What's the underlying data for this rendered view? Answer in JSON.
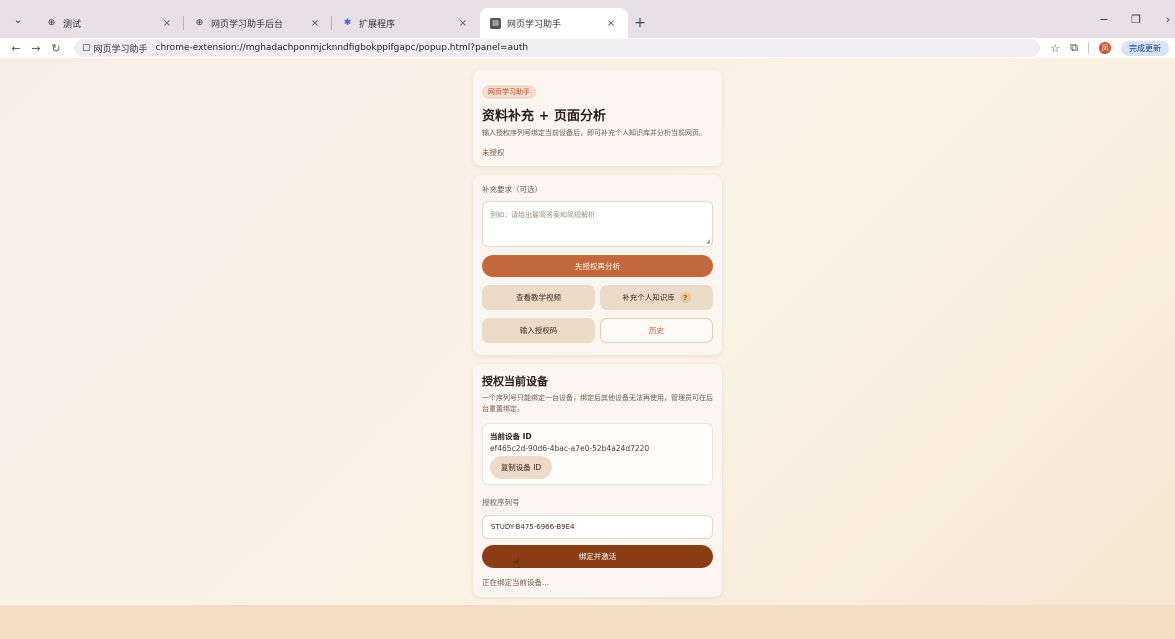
{
  "browser": {
    "tabs": [
      {
        "title": "测试",
        "icon": "globe-icon",
        "active": false
      },
      {
        "title": "网页学习助手后台",
        "icon": "globe-icon",
        "active": false
      },
      {
        "title": "扩展程序",
        "icon": "puzzle-icon",
        "active": false
      },
      {
        "title": "网页学习助手",
        "icon": "extension-page-icon",
        "active": true
      }
    ],
    "address_chip": "网页学习助手",
    "url": "chrome-extension://mghadachponmjcknndfigbokppifgapc/popup.html?panel=auth",
    "avatar_letter": "凤",
    "update_button": "完成更新"
  },
  "header": {
    "badge": "网页学习助手",
    "title": "资料补充 + 页面分析",
    "description": "输入授权序列号绑定当前设备后，即可补充个人知识库并分析当前网页。",
    "status": "未授权"
  },
  "supplement": {
    "label": "补充要求（可选）",
    "placeholder": "例如：请给出最简答案和简短解析",
    "primary_button": "先授权再分析",
    "video_button": "查看教学视频",
    "kb_button": "补充个人知识库",
    "help_mark": "?",
    "code_button": "输入授权码",
    "history_button": "历史"
  },
  "auth": {
    "title": "授权当前设备",
    "description": "一个序列号只能绑定一台设备，绑定后其他设备无法再使用，管理员可在后台重置绑定。",
    "device_label": "当前设备 ID",
    "device_id": "ef465c2d-90d6-4bac-a7e0-52b4a24d7220",
    "copy_button": "复制设备 ID",
    "serial_label": "授权序列号",
    "serial_value": "STUDY-B475-6966-B9E4",
    "bind_button": "绑定并激活",
    "status": "正在绑定当前设备..."
  },
  "colors": {
    "primary": "#c2683d",
    "dark": "#8b3d15",
    "accent_text": "#c2552f"
  }
}
